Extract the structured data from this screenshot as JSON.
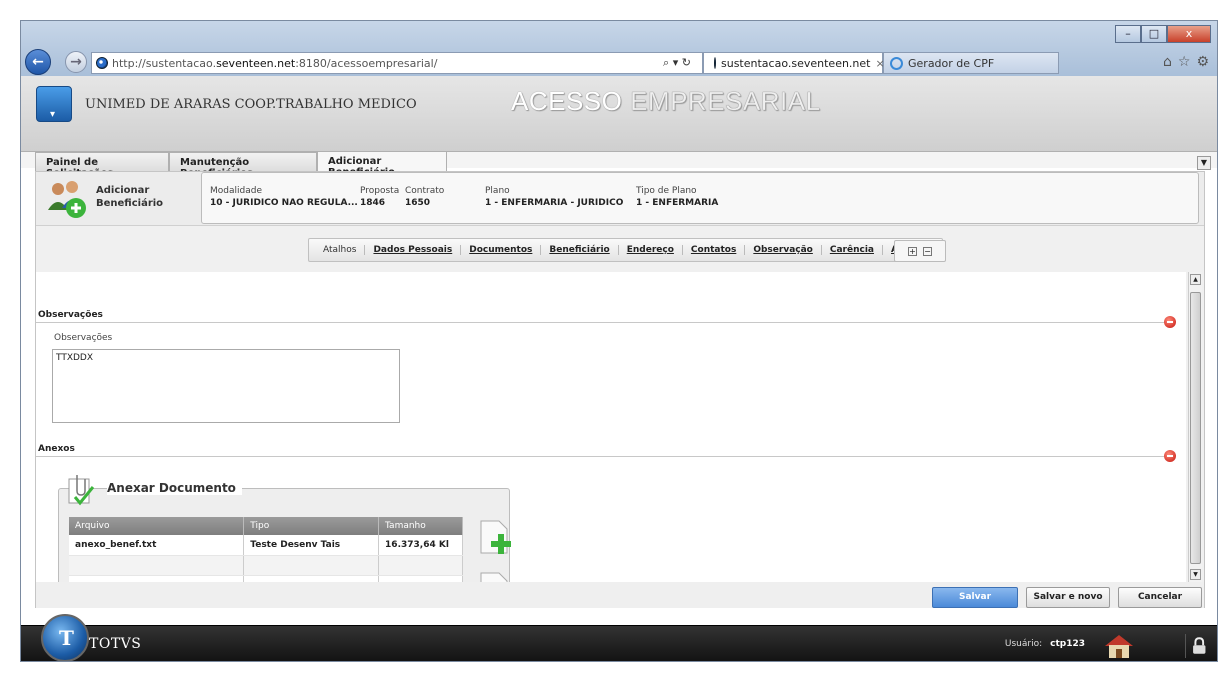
{
  "browser": {
    "url_prefix": "http://sustentacao.",
    "url_domain": "seventeen.net",
    "url_suffix": ":8180/acessoempresarial/",
    "url_tools": "⌕ ▾ ↻",
    "tabs": [
      {
        "label": "sustentacao.seventeen.net",
        "close": "×"
      },
      {
        "label": "Gerador de CPF"
      }
    ],
    "window_buttons": [
      "–",
      "□",
      "x"
    ],
    "right_icons": [
      "⌂",
      "☆",
      "⚙"
    ]
  },
  "app": {
    "company": "UNIMED DE ARARAS COOP.TRABALHO MEDICO",
    "title_part1": "ACESSO ",
    "title_part2": "EMPRESARIAL"
  },
  "tabs": [
    {
      "label": "Painel de Solicitações"
    },
    {
      "label": "Manutenção Beneficiários"
    },
    {
      "label": "Adicionar Beneficiário",
      "selected": true
    }
  ],
  "info": {
    "title_line1": "Adicionar",
    "title_line2": "Beneficiário",
    "fields": [
      {
        "label": "Modalidade",
        "value": "10 - JURIDICO NAO REGULA..."
      },
      {
        "label": "Proposta",
        "value": "1846"
      },
      {
        "label": "Contrato",
        "value": "1650"
      },
      {
        "label": "Plano",
        "value": "1 - ENFERMARIA - JURIDICO"
      },
      {
        "label": "Tipo de Plano",
        "value": "1 - ENFERMARIA"
      }
    ]
  },
  "shortcuts": {
    "label": "Atalhos",
    "links": [
      "Dados Pessoais",
      "Documentos",
      "Beneficiário",
      "Endereço",
      "Contatos",
      "Observação",
      "Carência",
      "Anexos"
    ],
    "expand": "+",
    "collapse": "−"
  },
  "observacoes": {
    "section_title": "Observações",
    "field_label": "Observações",
    "value": "TTXDDX"
  },
  "anexos": {
    "section_title": "Anexos",
    "box_title": "Anexar Documento",
    "columns": [
      "Arquivo",
      "Tipo",
      "Tamanho"
    ],
    "rows": [
      [
        "anexo_benef.txt",
        "Teste Desenv Tais",
        "16.373,64 Kl"
      ],
      [
        "",
        "",
        ""
      ],
      [
        "",
        "",
        ""
      ],
      [
        "",
        "",
        ""
      ]
    ]
  },
  "actions": {
    "save": "Salvar",
    "save_new": "Salvar e novo",
    "cancel": "Cancelar"
  },
  "footer": {
    "brand": "TOTVS",
    "user_label": "Usuário:",
    "user_name": "ctp123"
  },
  "colors": {
    "primary_button": "#4a89d8",
    "remove_icon": "#c4140c",
    "footer_bg": "#111111"
  }
}
